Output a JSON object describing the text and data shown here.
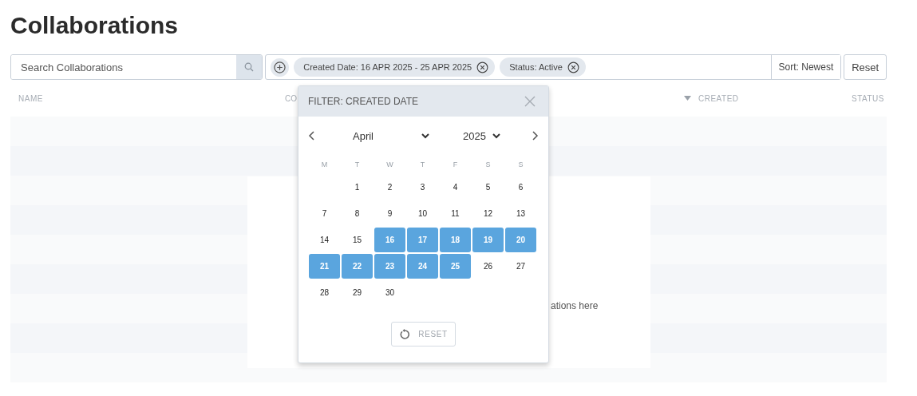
{
  "page_title": "Collaborations",
  "search": {
    "placeholder": "Search Collaborations"
  },
  "filter_chips": [
    {
      "label": "Created Date: 16 APR 2025 - 25 APR 2025"
    },
    {
      "label": "Status: Active"
    }
  ],
  "sort": {
    "label": "Sort: Newest"
  },
  "reset_button": "Reset",
  "table": {
    "columns": [
      {
        "label": "NAME",
        "kind": "plain"
      },
      {
        "label": "CO",
        "kind": "plain"
      },
      {
        "label": "CREATED",
        "kind": "sorted"
      },
      {
        "label": "STATUS",
        "kind": "plain"
      }
    ],
    "empty_message": "ations here"
  },
  "date_filter": {
    "title": "FILTER: CREATED DATE",
    "month": "April",
    "year": "2025",
    "weekdays": [
      "M",
      "T",
      "W",
      "T",
      "F",
      "S",
      "S"
    ],
    "weeks": [
      [
        {
          "kind": "blank"
        },
        {
          "kind": "day",
          "label": "1",
          "selected": false
        },
        {
          "kind": "day",
          "label": "2",
          "selected": false
        },
        {
          "kind": "day",
          "label": "3",
          "selected": false
        },
        {
          "kind": "day",
          "label": "4",
          "selected": false
        },
        {
          "kind": "day",
          "label": "5",
          "selected": false
        },
        {
          "kind": "day",
          "label": "6",
          "selected": false
        }
      ],
      [
        {
          "kind": "day",
          "label": "7",
          "selected": false
        },
        {
          "kind": "day",
          "label": "8",
          "selected": false
        },
        {
          "kind": "day",
          "label": "9",
          "selected": false
        },
        {
          "kind": "day",
          "label": "10",
          "selected": false
        },
        {
          "kind": "day",
          "label": "11",
          "selected": false
        },
        {
          "kind": "day",
          "label": "12",
          "selected": false
        },
        {
          "kind": "day",
          "label": "13",
          "selected": false
        }
      ],
      [
        {
          "kind": "day",
          "label": "14",
          "selected": false
        },
        {
          "kind": "day",
          "label": "15",
          "selected": false
        },
        {
          "kind": "day",
          "label": "16",
          "selected": true
        },
        {
          "kind": "day",
          "label": "17",
          "selected": true
        },
        {
          "kind": "day",
          "label": "18",
          "selected": true
        },
        {
          "kind": "day",
          "label": "19",
          "selected": true
        },
        {
          "kind": "day",
          "label": "20",
          "selected": true
        }
      ],
      [
        {
          "kind": "day",
          "label": "21",
          "selected": true
        },
        {
          "kind": "day",
          "label": "22",
          "selected": true
        },
        {
          "kind": "day",
          "label": "23",
          "selected": true
        },
        {
          "kind": "day",
          "label": "24",
          "selected": true
        },
        {
          "kind": "day",
          "label": "25",
          "selected": true
        },
        {
          "kind": "day",
          "label": "26",
          "selected": false
        },
        {
          "kind": "day",
          "label": "27",
          "selected": false
        }
      ],
      [
        {
          "kind": "day",
          "label": "28",
          "selected": false
        },
        {
          "kind": "day",
          "label": "29",
          "selected": false
        },
        {
          "kind": "day",
          "label": "30",
          "selected": false
        }
      ]
    ],
    "reset_button": "RESET"
  }
}
